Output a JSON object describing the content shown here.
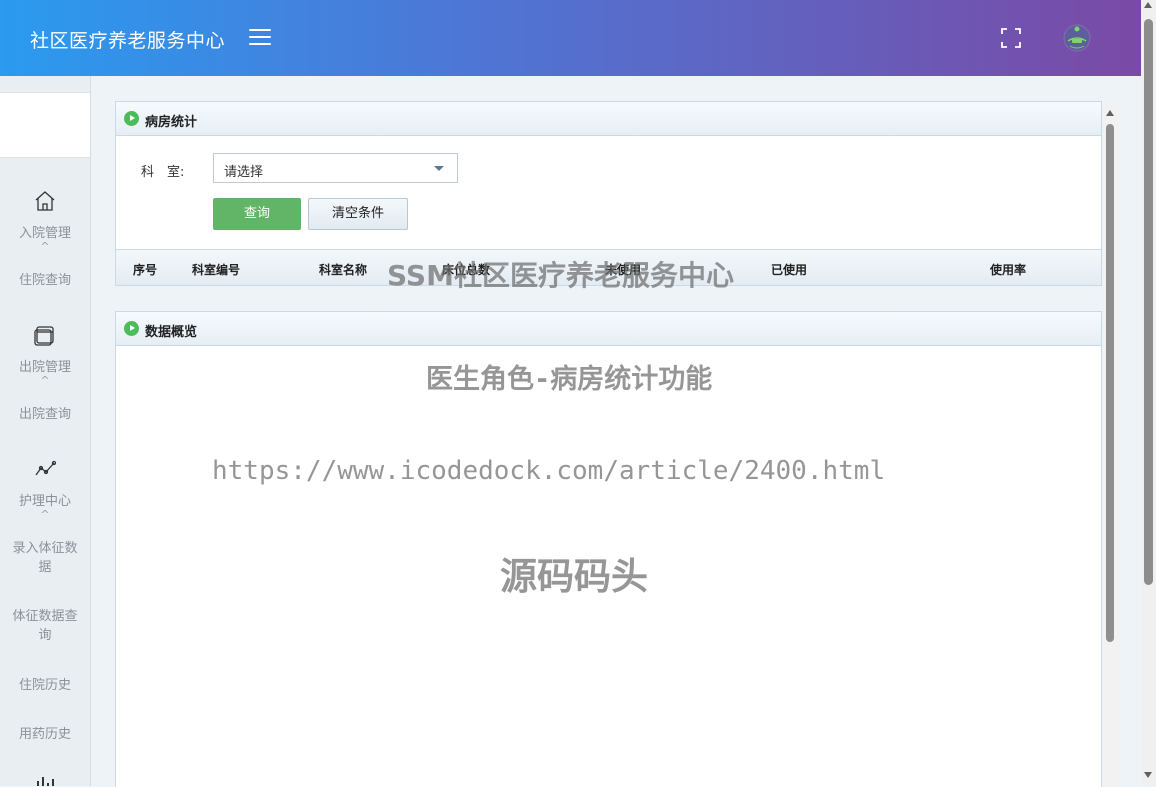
{
  "header": {
    "title": "社区医疗养老服务中心",
    "menu_icon": "hamburger-menu-icon",
    "fullscreen_icon": "fullscreen-icon",
    "avatar_icon": "user-avatar-icon"
  },
  "sidebar": {
    "groups": [
      {
        "label": "入院管理",
        "icon": "home-icon",
        "caret": "^",
        "sub": [
          "住院查询"
        ]
      },
      {
        "label": "出院管理",
        "icon": "window-icon",
        "caret": "^",
        "sub": [
          "出院查询"
        ]
      },
      {
        "label": "护理中心",
        "icon": "line-chart-icon",
        "caret": "^",
        "sub": [
          "录入体征数据",
          "体征数据查询",
          "住院历史",
          "用药历史"
        ]
      },
      {
        "icon": "bar-chart-icon"
      }
    ]
  },
  "ward_panel": {
    "title": "病房统计",
    "dept_label": "科　室:",
    "dept_select_value": "请选择",
    "query_button": "查询",
    "clear_button": "清空条件",
    "columns": [
      "序号",
      "科室编号",
      "科室名称",
      "床位总数",
      "未使用",
      "已使用",
      "使用率"
    ]
  },
  "overview_panel": {
    "title": "数据概览"
  },
  "watermarks": {
    "line1": "SSM社区医疗养老服务中心",
    "line2": "医生角色-病房统计功能",
    "line3": "https://www.icodedock.com/article/2400.html",
    "line4": "源码码头"
  },
  "colors": {
    "header_gradient_start": "#2a9bef",
    "header_gradient_end": "#7a4aa6",
    "query_button": "#62b566",
    "panel_icon": "#4cbb5c"
  }
}
